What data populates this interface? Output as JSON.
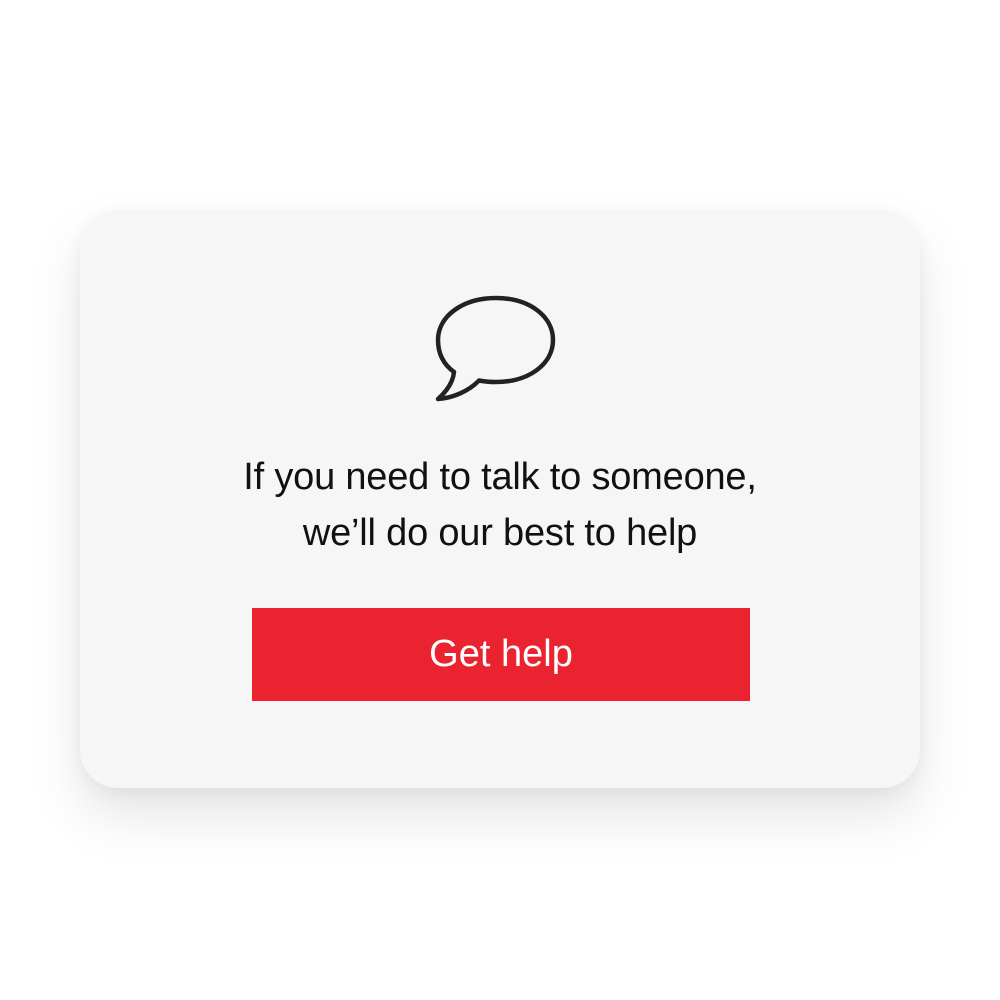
{
  "card": {
    "icon": "speech-bubble-icon",
    "message_line1": "If you need to talk to someone,",
    "message_line2": "we’ll do our best to help",
    "button_label": "Get help"
  },
  "colors": {
    "button_background": "#eb2330",
    "button_text": "#ffffff",
    "card_background": "#f6f6f6",
    "text": "#111111",
    "icon_stroke": "#222222"
  }
}
